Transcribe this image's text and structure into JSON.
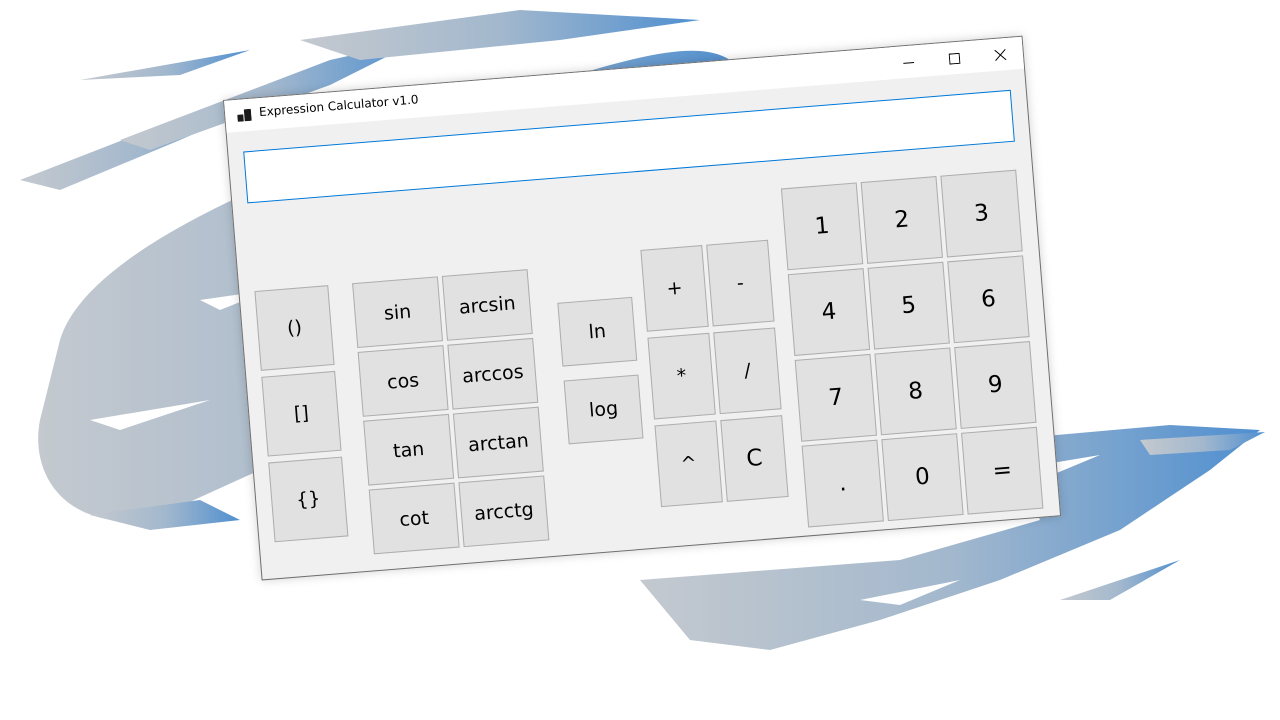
{
  "window": {
    "title": "Expression Calculator v1.0"
  },
  "expression": {
    "value": ""
  },
  "colors": {
    "splash_left": "#c4c9cf",
    "splash_right": "#4f8fd0",
    "window_bg": "#f0f0f0",
    "button_bg": "#e1e1e1",
    "button_border": "#adadad",
    "input_border": "#0078d7"
  },
  "icons": {
    "app": "app-icon",
    "minimize": "minimize-icon",
    "maximize": "maximize-icon",
    "close": "close-icon"
  },
  "buttons": {
    "brackets": [
      "()",
      "[]",
      "{}"
    ],
    "trig": [
      "sin",
      "cos",
      "tan",
      "cot"
    ],
    "arc_trig": [
      "arcsin",
      "arccos",
      "arctan",
      "arcctg"
    ],
    "logs": [
      "ln",
      "log"
    ],
    "operators": [
      "+",
      "-",
      "*",
      "/",
      "^",
      "C"
    ],
    "digits": [
      "1",
      "2",
      "3",
      "4",
      "5",
      "6",
      "7",
      "8",
      "9",
      ".",
      "0",
      "="
    ]
  }
}
